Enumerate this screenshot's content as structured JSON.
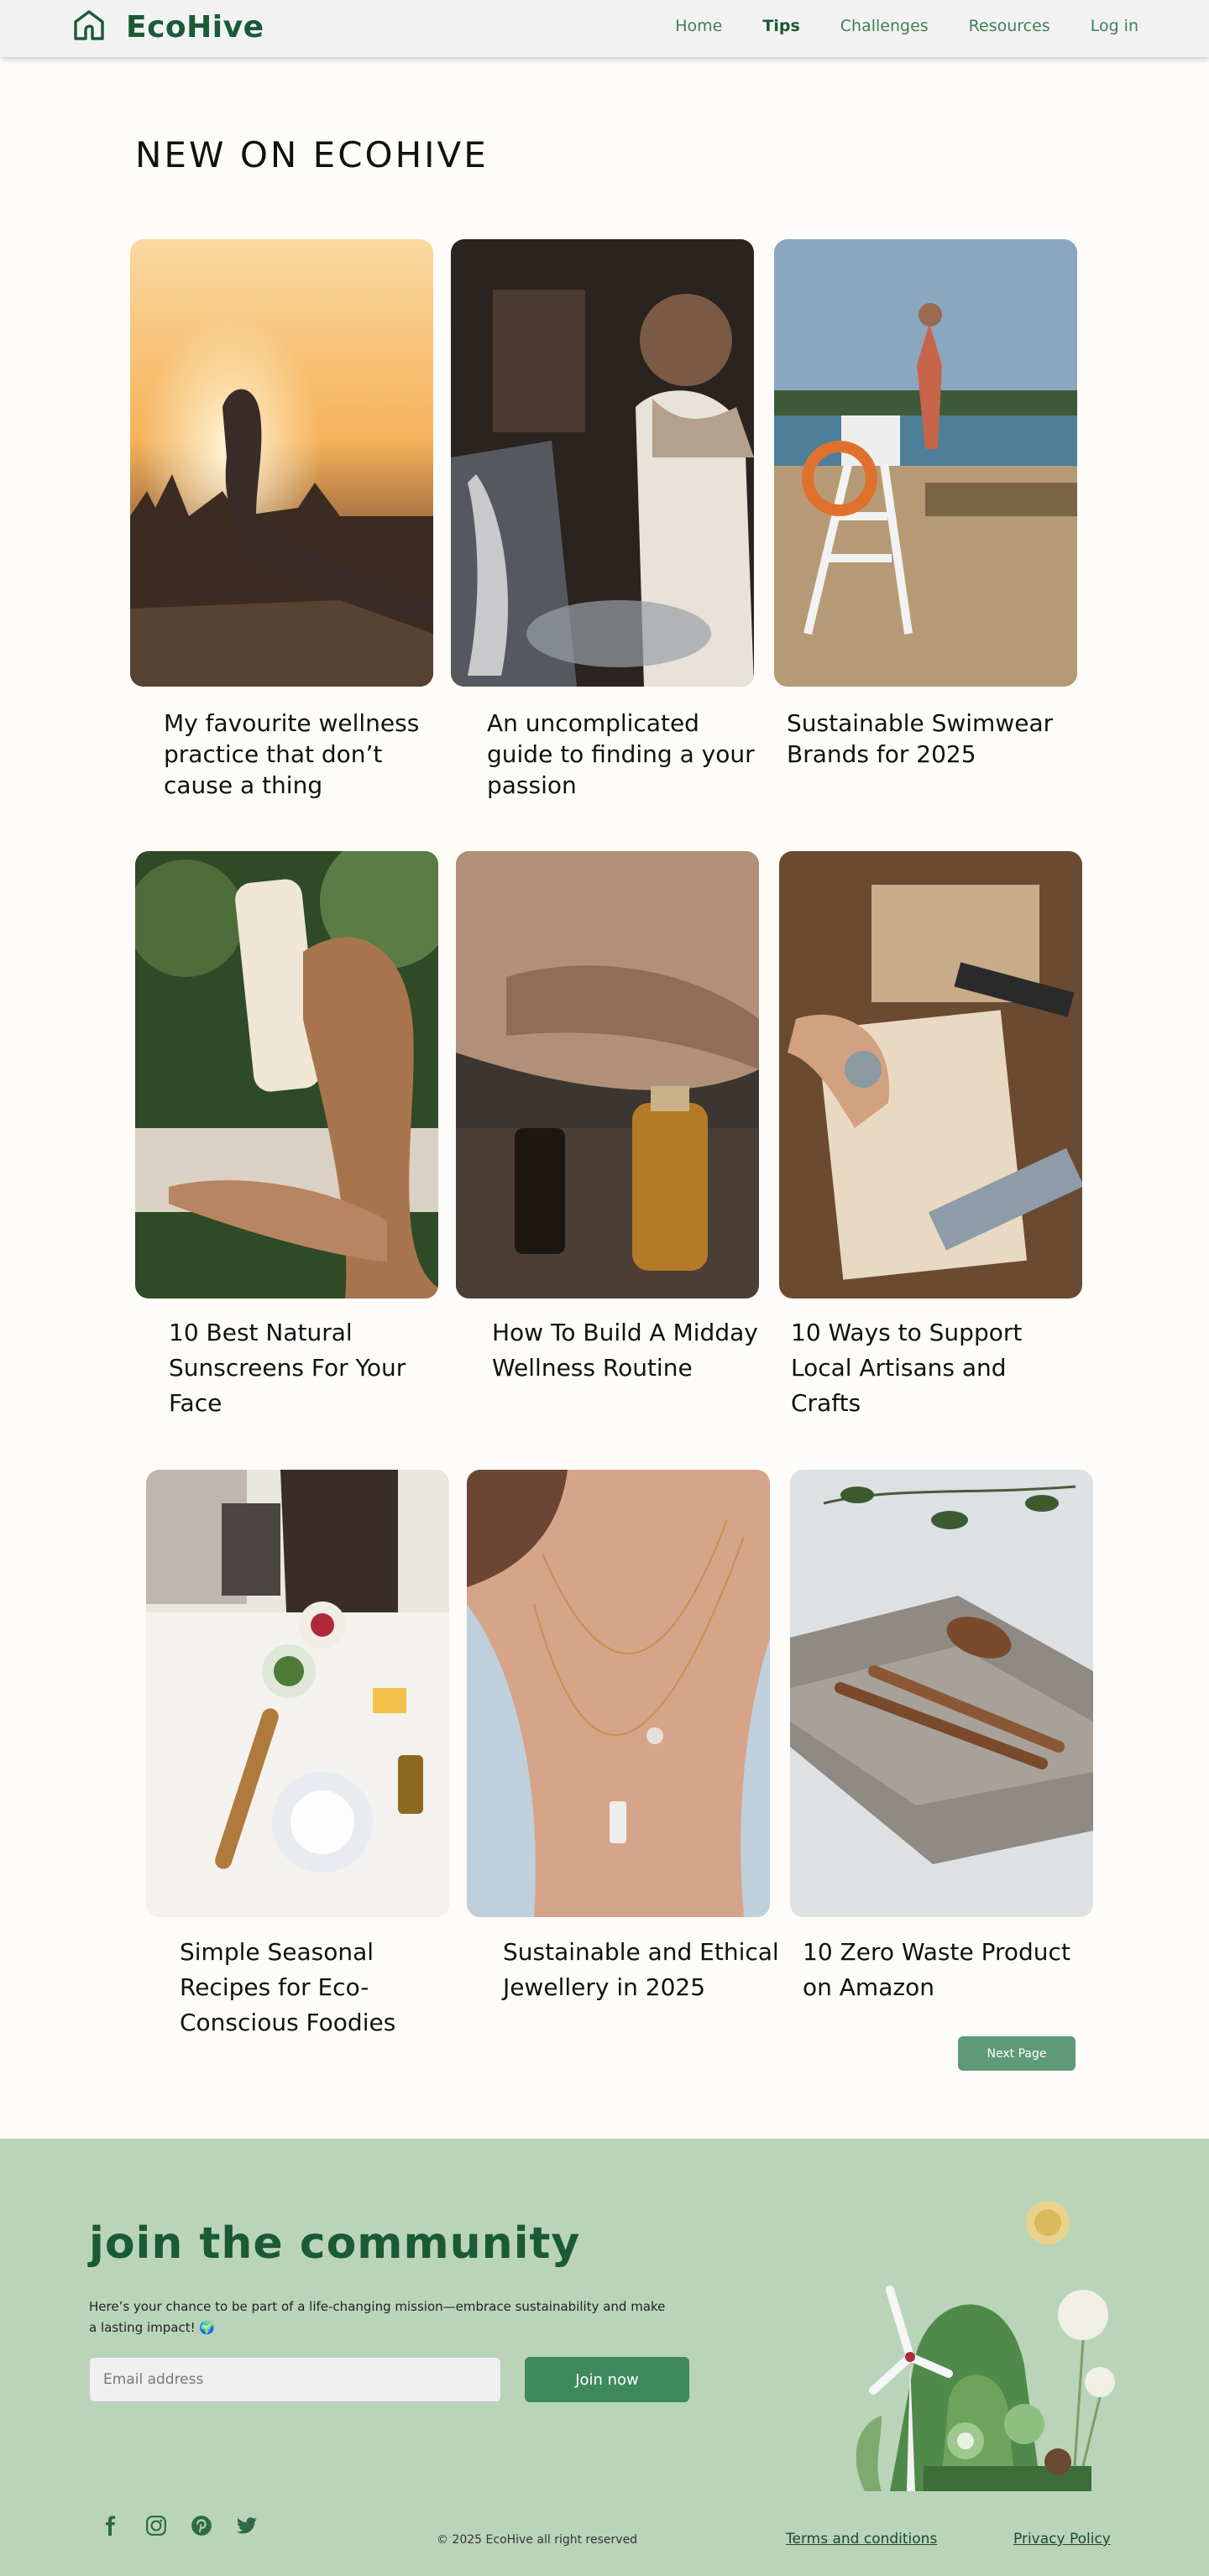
{
  "header": {
    "brand": "EcoHive",
    "logo_icon": "house-leaf-icon",
    "nav": [
      {
        "label": "Home",
        "active": false
      },
      {
        "label": "Tips",
        "active": true
      },
      {
        "label": "Challenges",
        "active": false
      },
      {
        "label": "Resources",
        "active": false
      },
      {
        "label": "Log in",
        "active": false
      }
    ]
  },
  "main": {
    "section_title": "NEW ON ECOHIVE",
    "articles": [
      {
        "title": "My favourite wellness practice that don’t cause a thing",
        "image": "yoga-sunset-photo"
      },
      {
        "title": "An uncomplicated guide to finding a your passion",
        "image": "woman-painting-photo"
      },
      {
        "title": "Sustainable Swimwear Brands for 2025",
        "image": "lifeguard-tower-photo"
      },
      {
        "title": "10 Best Natural Sunscreens For Your Face",
        "image": "sunscreen-hand-photo"
      },
      {
        "title": "How To Build A Midday  Wellness Routine",
        "image": "oil-bottles-photo"
      },
      {
        "title": "10 Ways to Support Local Artisans and Crafts",
        "image": "artisan-craft-photo"
      },
      {
        "title": "Simple Seasonal Recipes for Eco-Conscious  Foodies",
        "image": "cooking-kitchen-photo"
      },
      {
        "title": "Sustainable and Ethical Jewellery in 2025",
        "image": "necklace-photo"
      },
      {
        "title": "10 Zero Waste Product on Amazon",
        "image": "wooden-cutlery-photo"
      }
    ],
    "next_label": "Next Page"
  },
  "footer": {
    "join_title": "join the community",
    "join_desc": "Here’s your chance to be part of a life-changing mission—embrace sustainability and make a lasting impact! 🌍",
    "email_placeholder": "Email address",
    "join_button": "Join now",
    "copyright": "© 2025 EcoHive all right reserved",
    "terms": "Terms and conditions",
    "privacy": "Privacy Policy",
    "social_icons": [
      "facebook-icon",
      "instagram-icon",
      "pinterest-icon",
      "twitter-icon"
    ]
  },
  "colors": {
    "brand_green": "#1a5a35",
    "accent_green": "#3f8a5c",
    "footer_bg": "#bad4b9",
    "page_bg": "#fdfcf8"
  }
}
